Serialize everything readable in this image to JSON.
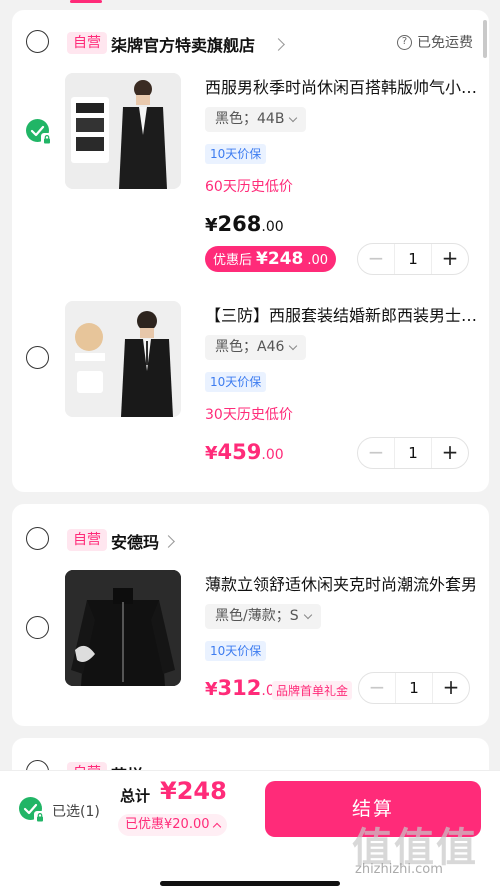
{
  "shops": [
    {
      "tag": "自营",
      "name": "柒牌官方特卖旗舰店",
      "free_shipping": "已免运费",
      "products": [
        {
          "title": "西服男秋季时尚休闲百搭韩版帅气小西装",
          "sku": "黑色；44B",
          "guarantee": "10天价保",
          "history_low": "60天历史低价",
          "price_symbol": "¥",
          "price_int": "268",
          "price_dec": ".00",
          "discount_label": "优惠后",
          "discount_price": "¥248",
          "discount_dec": ".00",
          "quantity": "1",
          "checked": true
        },
        {
          "title": "【三防】西服套装结婚新郎西装男士正装",
          "sku": "黑色；A46",
          "guarantee": "10天价保",
          "history_low": "30天历史低价",
          "price_symbol": "¥",
          "price_int": "459",
          "price_dec": ".00",
          "quantity": "1",
          "checked": false
        }
      ]
    },
    {
      "tag": "自营",
      "name": "安德玛",
      "products": [
        {
          "title": "薄款立领舒适休闲夹克时尚潮流外套男",
          "sku": "黑色/薄款；S",
          "guarantee": "10天价保",
          "price_symbol": "¥",
          "price_int": "312",
          "price_dec": ".00",
          "gift_label": "品牌首单礼金",
          "quantity": "1",
          "checked": false
        }
      ]
    },
    {
      "tag": "自营",
      "name": "花样"
    }
  ],
  "bottom": {
    "selected": "已选(1)",
    "total_label": "总计",
    "total_value": "¥248",
    "saved": "已优惠¥20.00",
    "checkout": "结算"
  },
  "watermark": {
    "text": "值值值",
    "url": "zhizhizhi.com"
  },
  "colors": {
    "accent": "#ff2b79",
    "check": "#21b566",
    "tag_blue": "#3d7cf0"
  }
}
